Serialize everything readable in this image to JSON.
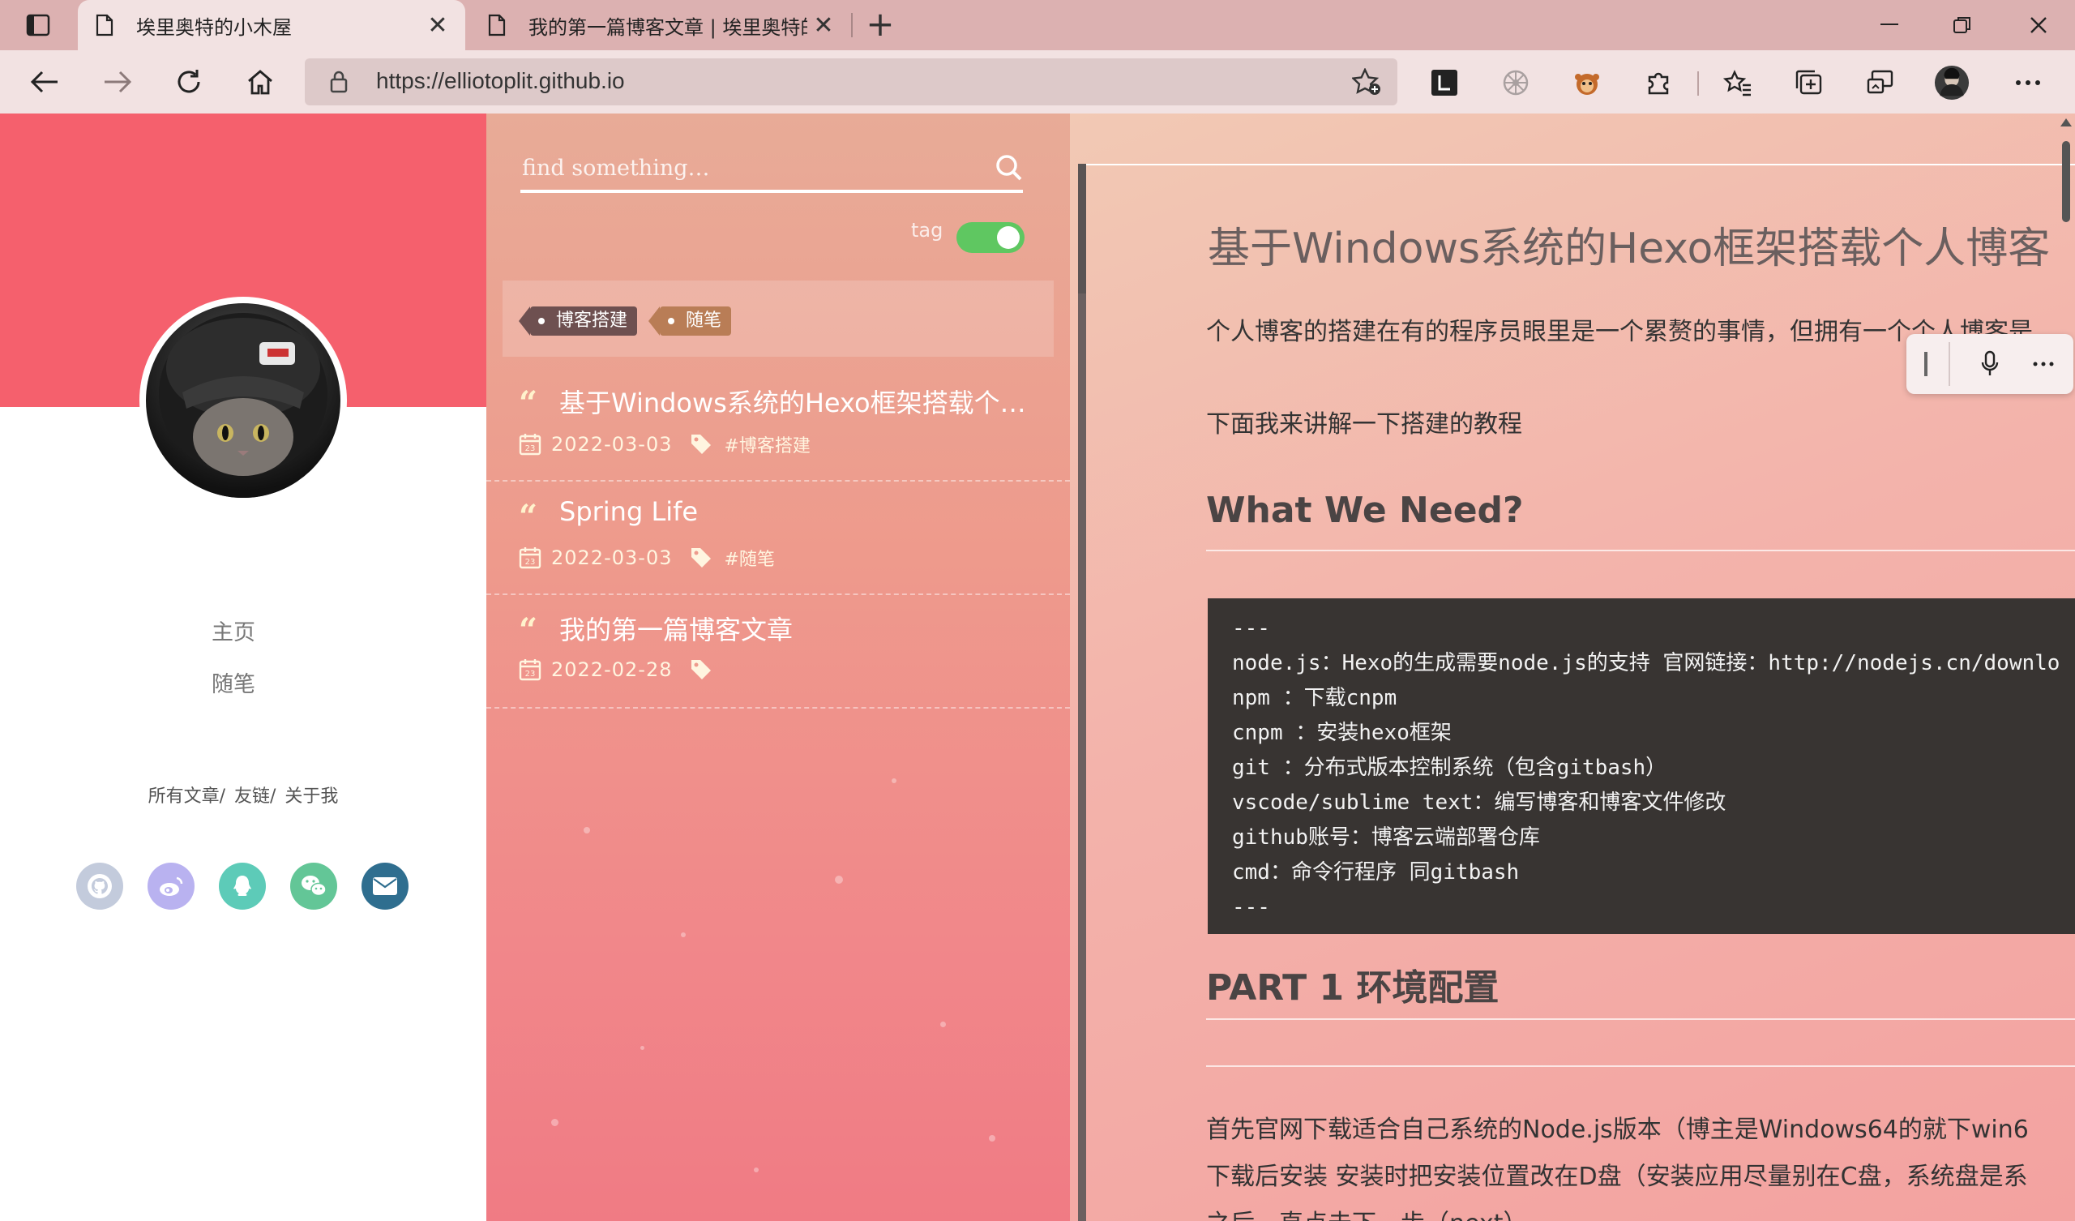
{
  "browser": {
    "tabs": [
      {
        "title": "埃里奥特的小木屋",
        "active": true
      },
      {
        "title": "我的第一篇博客文章 | 埃里奥特的",
        "active": false
      }
    ],
    "address": {
      "url": "https://elliotoplit.github.io"
    }
  },
  "sidebar": {
    "menu": [
      "主页",
      "随笔"
    ],
    "footer_links": [
      "所有文章/",
      "友链/",
      "关于我"
    ],
    "social": [
      {
        "icon": "github-icon",
        "color": "#c3cbdc"
      },
      {
        "icon": "weibo-icon",
        "color": "#b9b2f0"
      },
      {
        "icon": "qq-icon",
        "color": "#5dcbb8"
      },
      {
        "icon": "wechat-icon",
        "color": "#63c697"
      },
      {
        "icon": "mail-icon",
        "color": "#2f6e8f"
      }
    ]
  },
  "middle": {
    "search_placeholder": "find something…",
    "tag_toggle_label": "tag",
    "tags": [
      {
        "label": "博客搭建",
        "color": "#6e5050"
      },
      {
        "label": "随笔",
        "color": "#b97d56"
      }
    ],
    "posts": [
      {
        "title": "基于Windows系统的Hexo框架搭载个人博客",
        "date": "2022-03-03",
        "tag": "#博客搭建"
      },
      {
        "title": "Spring Life",
        "date": "2022-03-03",
        "tag": "#随笔"
      },
      {
        "title": "我的第一篇博客文章",
        "date": "2022-02-28",
        "tag": ""
      }
    ]
  },
  "article": {
    "title": "基于Windows系统的Hexo框架搭载个人博客",
    "intro": "个人博客的搭建在有的程序员眼里是一个累赘的事情，但拥有一个个人博客是",
    "intro2": "下面我来讲解一下搭建的教程",
    "h2_need": "What We Need?",
    "code_lines": [
      "---",
      "node.js：Hexo的生成需要node.js的支持 官网链接：http://nodejs.cn/downlo",
      "npm ：下载cnpm",
      "cnpm ：安装hexo框架",
      "git ：分布式版本控制系统（包含gitbash）",
      "vscode/sublime text：编写博客和博客文件修改",
      "github账号：博客云端部署仓库",
      "cmd：命令行程序 同gitbash",
      "---"
    ],
    "h2_part1": "PART 1 环境配置",
    "p1": "首先官网下载适合自己系统的Node.js版本（博主是Windows64的就下win6",
    "p2": "下载后安装 安装时把安装位置改在D盘（安装应用尽量别在C盘，系统盘是系",
    "p3": "之后一直点击下一步（next）"
  }
}
